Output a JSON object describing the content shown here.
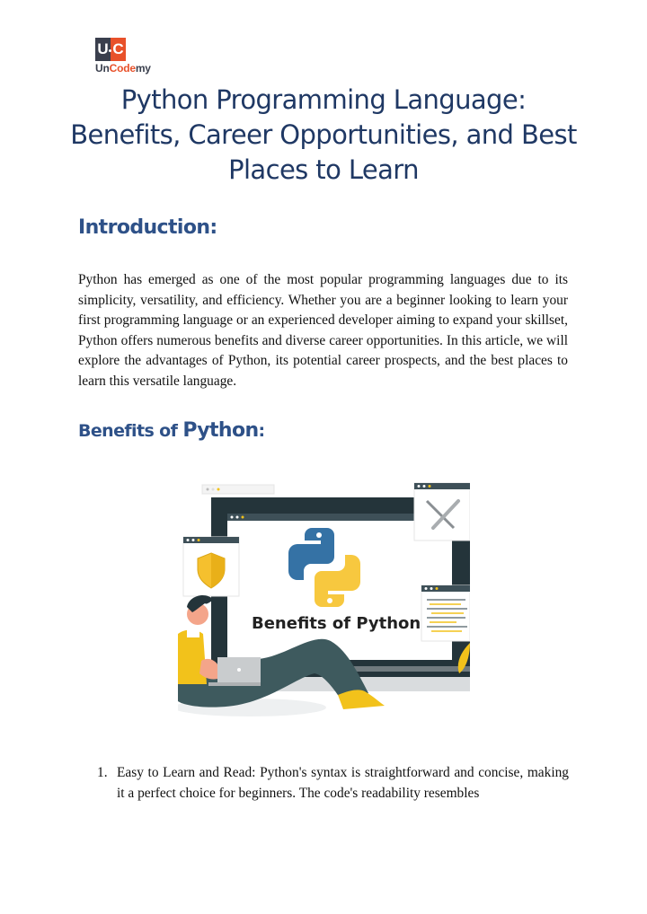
{
  "logo": {
    "mark_left": "U",
    "mark_right": "C",
    "brand_part1": "Un",
    "brand_part2": "Code",
    "brand_part3": "my",
    "colors": {
      "dark": "#3a3f4d",
      "orange": "#e8512a"
    }
  },
  "document": {
    "title": "Python Programming Language: Benefits, Career Opportunities, and Best Places to Learn",
    "introduction": {
      "heading": "Introduction:",
      "body": "Python has emerged as one of the most popular programming languages due to its simplicity, versatility, and efficiency. Whether you are a beginner looking to learn your first programming language or an experienced developer aiming to expand your skillset, Python offers numerous benefits and diverse career opportunities. In this article, we will explore the advantages of Python, its potential career prospects, and the best places to learn this versatile language."
    },
    "benefits": {
      "heading_part1": "Benefits of ",
      "heading_part2": "Python",
      "heading_part3": ":",
      "figure": {
        "caption_text": "Benefits of Python",
        "icons": [
          "python-logo",
          "shield-icon",
          "tools-icon",
          "code-window-icon",
          "person-with-laptop"
        ]
      },
      "items": [
        {
          "number": "1.",
          "text": "Easy to Learn and Read: Python's syntax is straightforward and concise, making it a perfect choice for beginners. The code's readability resembles"
        }
      ]
    },
    "colors": {
      "title": "#1f3864",
      "heading": "#2e5188",
      "body": "#111111"
    }
  }
}
